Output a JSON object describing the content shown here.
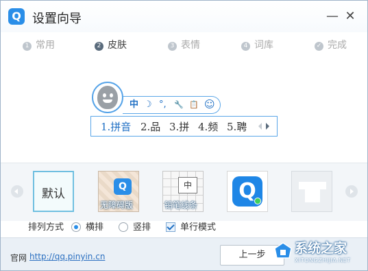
{
  "window": {
    "logo_letter": "Q",
    "title": "设置向导",
    "minimize_glyph": "—",
    "close_glyph": "✕"
  },
  "steps": [
    {
      "num": "1",
      "label": "常用",
      "state": "done"
    },
    {
      "num": "2",
      "label": "皮肤",
      "state": "active"
    },
    {
      "num": "3",
      "label": "表情",
      "state": "pending"
    },
    {
      "num": "4",
      "label": "词库",
      "state": "pending"
    },
    {
      "num": "✓",
      "label": "完成",
      "state": "pending"
    }
  ],
  "preview": {
    "toolbar": {
      "mode": "中",
      "moon": "☽",
      "punct": "°,",
      "wrench": "🔧",
      "clip": "📋",
      "smile": "☺"
    },
    "candidates": [
      "1.拼音",
      "2.品",
      "3.拼",
      "4.频",
      "5.聘"
    ]
  },
  "skins": [
    {
      "id": "default",
      "label": "默认"
    },
    {
      "id": "noblock",
      "label": "无障碍版"
    },
    {
      "id": "pencil",
      "label": "铅笔线条",
      "char": "中"
    },
    {
      "id": "blueq",
      "label": "Q"
    },
    {
      "id": "shirt",
      "label": "shirt-icon"
    }
  ],
  "options": {
    "layout_label": "排列方式",
    "horizontal": "横排",
    "vertical": "竖排",
    "selected": "horizontal",
    "single_row": "单行模式",
    "single_row_checked": true
  },
  "footer": {
    "site_label": "官网",
    "site_url": "http://qq.pinyin.cn",
    "prev_button": "上一步"
  },
  "watermark": {
    "text": "系统之家",
    "sub": "XITONGZHIJIA.NET"
  },
  "colors": {
    "accent": "#2a8ee8",
    "link": "#2a6fc0",
    "footer_bg": "#eaf0f6"
  }
}
